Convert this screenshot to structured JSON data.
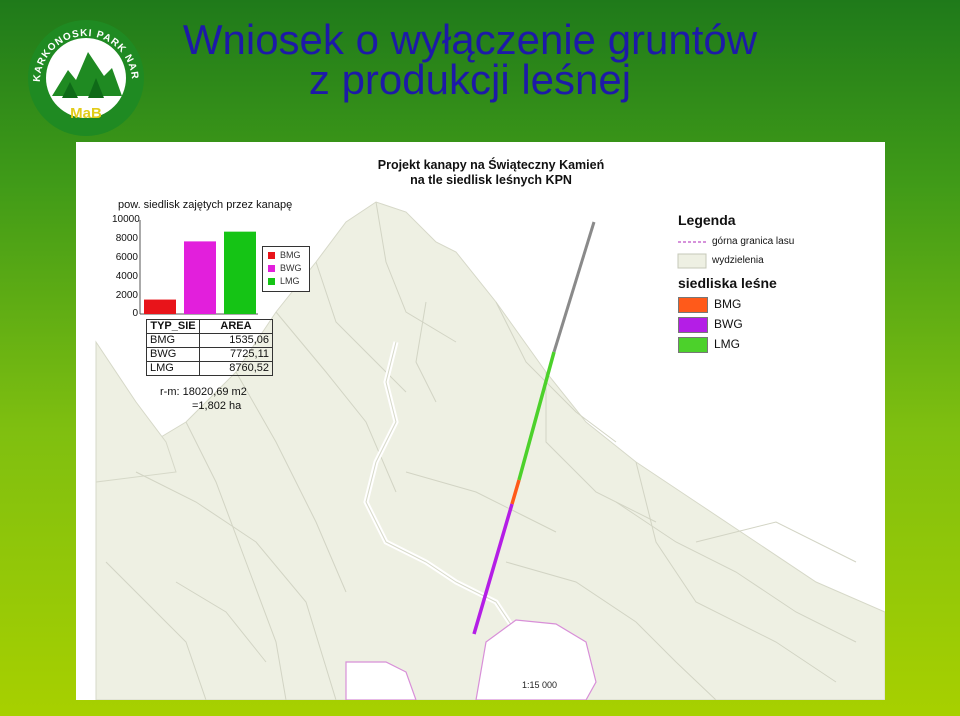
{
  "slide": {
    "title_line1": "Wniosek o wyłączenie gruntów",
    "title_line2": "z produkcji leśnej"
  },
  "logo": {
    "arc_text": "KARKONOSKI PARK NARODOWY",
    "mark_text": "MaB"
  },
  "map": {
    "title_line1": "Projekt kanapy na Świąteczny Kamień",
    "title_line2": "na tle siedlisk leśnych KPN",
    "scale": "1:15 000"
  },
  "chart_data": {
    "type": "bar",
    "title": "pow. siedlisk zajętych przez kanapę",
    "categories": [
      "BMG",
      "BWG",
      "LMG"
    ],
    "values": [
      1535.06,
      7725.11,
      8760.52
    ],
    "ylim": [
      0,
      10000
    ],
    "yticks": [
      "10000",
      "8000",
      "6000",
      "4000",
      "2000",
      "0"
    ],
    "colors": [
      "#e8141a",
      "#e21fdc",
      "#15c415"
    ],
    "legend": [
      "BMG",
      "BWG",
      "LMG"
    ],
    "legend_position": "right",
    "grid": false
  },
  "area_table": {
    "headers": [
      "TYP_SIE",
      "AREA"
    ],
    "rows": [
      {
        "name": "BMG",
        "area": "1535,06"
      },
      {
        "name": "BWG",
        "area": "7725,11"
      },
      {
        "name": "LMG",
        "area": "8760,52"
      }
    ]
  },
  "summary": {
    "line1": "r-m: 18020,69 m2",
    "line2": "=1,802 ha"
  },
  "legend": {
    "title": "Legenda",
    "forest_border_label": "górna granica lasu",
    "subdivision_label": "wydzielenia",
    "habitats_title": "siedliska leśne",
    "items": [
      {
        "label": "BMG",
        "color": "#ff5a1a"
      },
      {
        "label": "BWG",
        "color": "#b41ee6"
      },
      {
        "label": "LMG",
        "color": "#4cd12b"
      }
    ],
    "forest_border_color": "#c86fcf",
    "subdivision_color": "#eef0e3"
  }
}
